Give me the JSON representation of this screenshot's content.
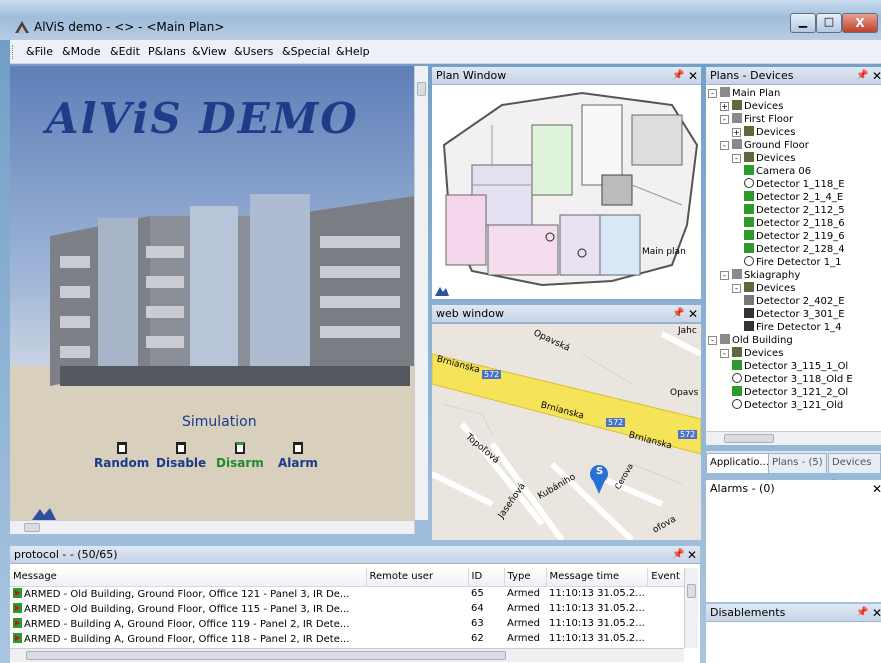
{
  "window": {
    "title": "AlViS demo - <> - <Main Plan>",
    "close_glyph": "X",
    "minimize_glyph": "▁",
    "maximize_glyph": "□"
  },
  "menu": [
    "&File",
    "&Mode",
    "&Edit",
    "P&lans",
    "&View",
    "&Users",
    "&Special",
    "&Help"
  ],
  "scene": {
    "title": "AlViS DEMO",
    "simulation_label": "Simulation",
    "buttons": [
      "Random",
      "Disable",
      "Disarm",
      "Alarm"
    ]
  },
  "plan_window": {
    "title": "Plan Window",
    "main_plan_label": "Main plan"
  },
  "web_window": {
    "title": "web window",
    "streets": [
      "Brnianska",
      "Brnianska",
      "Brnianska",
      "Topoľová",
      "Jaseňová",
      "Kubániho",
      "Opavská",
      "Opavs",
      "Jahc",
      "Cerova",
      "ofova"
    ],
    "road_badges": [
      "572",
      "572",
      "572"
    ],
    "marker_label": "S"
  },
  "devices_panel": {
    "title": "Plans - Devices",
    "tree": [
      {
        "level": 0,
        "expander": "-",
        "icon": "plan",
        "label": "Main Plan"
      },
      {
        "level": 1,
        "expander": "+",
        "icon": "devices",
        "label": "Devices"
      },
      {
        "level": 1,
        "expander": "-",
        "icon": "plan",
        "label": "First Floor"
      },
      {
        "level": 2,
        "expander": "+",
        "icon": "devices",
        "label": "Devices"
      },
      {
        "level": 1,
        "expander": "-",
        "icon": "plan",
        "label": "Ground Floor"
      },
      {
        "level": 2,
        "expander": "-",
        "icon": "devices",
        "label": "Devices"
      },
      {
        "level": 3,
        "expander": "",
        "icon": "camera",
        "label": "Camera 06"
      },
      {
        "level": 3,
        "expander": "",
        "icon": "fire",
        "label": "Detector 1_118_E"
      },
      {
        "level": 3,
        "expander": "",
        "icon": "ir",
        "label": "Detector 2_1_4_E"
      },
      {
        "level": 3,
        "expander": "",
        "icon": "ir",
        "label": "Detector 2_112_5"
      },
      {
        "level": 3,
        "expander": "",
        "icon": "ir",
        "label": "Detector 2_118_6"
      },
      {
        "level": 3,
        "expander": "",
        "icon": "ir",
        "label": "Detector 2_119_6"
      },
      {
        "level": 3,
        "expander": "",
        "icon": "ir",
        "label": "Detector 2_128_4"
      },
      {
        "level": 3,
        "expander": "",
        "icon": "fire",
        "label": "Fire Detector 1_1"
      },
      {
        "level": 1,
        "expander": "-",
        "icon": "plan",
        "label": "Skiagraphy"
      },
      {
        "level": 2,
        "expander": "-",
        "icon": "devices",
        "label": "Devices"
      },
      {
        "level": 3,
        "expander": "",
        "icon": "ir-gray",
        "label": "Detector 2_402_E"
      },
      {
        "level": 3,
        "expander": "",
        "icon": "box",
        "label": "Detector 3_301_E"
      },
      {
        "level": 3,
        "expander": "",
        "icon": "box",
        "label": "Fire Detector 1_4"
      },
      {
        "level": 0,
        "expander": "-",
        "icon": "plan",
        "label": "Old Building"
      },
      {
        "level": 1,
        "expander": "-",
        "icon": "devices",
        "label": "Devices"
      },
      {
        "level": 2,
        "expander": "",
        "icon": "ir",
        "label": "Detector 3_115_1_Ol"
      },
      {
        "level": 2,
        "expander": "",
        "icon": "fire",
        "label": "Detector 3_118_Old E"
      },
      {
        "level": 2,
        "expander": "",
        "icon": "ir",
        "label": "Detector 3_121_2_Ol"
      },
      {
        "level": 2,
        "expander": "",
        "icon": "fire",
        "label": "Detector 3_121_Old"
      }
    ],
    "tabs": [
      "Applicatio...",
      "Plans - (5)",
      "Devices - ..."
    ]
  },
  "alarms": {
    "title": "Alarms - (0)"
  },
  "disablements": {
    "title": "Disablements"
  },
  "protocol": {
    "title": "protocol -  - (50/65)",
    "columns": [
      "Message",
      "Remote user",
      "ID",
      "Type",
      "Message time",
      "Event"
    ],
    "rows": [
      {
        "message": "ARMED - Old Building, Ground Floor, Office 121 - Panel 3, IR De...",
        "user": "",
        "id": "65",
        "type": "Armed",
        "time": "11:10:13  31.05.2..."
      },
      {
        "message": "ARMED - Old Building, Ground Floor, Office 115 - Panel 3, IR De...",
        "user": "",
        "id": "64",
        "type": "Armed",
        "time": "11:10:13  31.05.2..."
      },
      {
        "message": "ARMED - Building A, Ground Floor, Office 119 - Panel 2, IR Dete...",
        "user": "",
        "id": "63",
        "type": "Armed",
        "time": "11:10:13  31.05.2..."
      },
      {
        "message": "ARMED - Building A, Ground Floor, Office 118 - Panel 2, IR Dete...",
        "user": "",
        "id": "62",
        "type": "Armed",
        "time": "11:10:13  31.05.2..."
      }
    ]
  },
  "colors": {
    "accent": "#1e3c88",
    "armed_green": "#2c9a2c",
    "map_road": "#f5e35a"
  }
}
